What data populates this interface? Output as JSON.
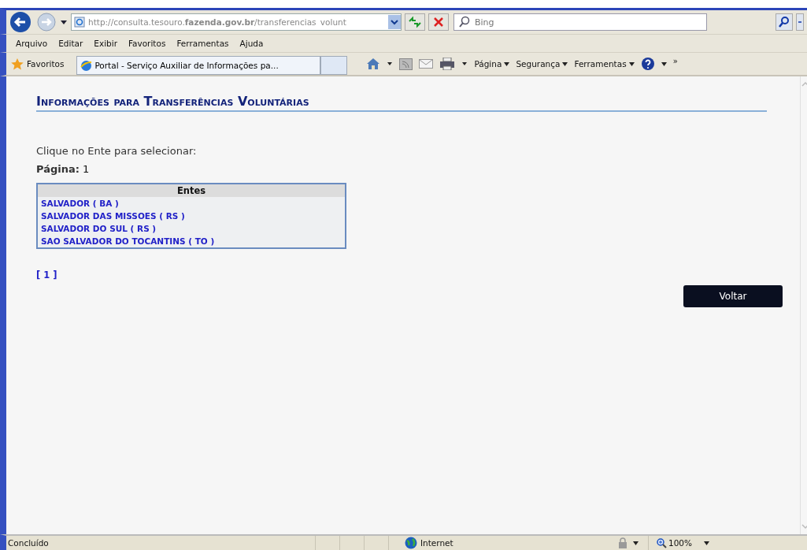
{
  "address_bar": {
    "url": "http://consulta.tesouro.**fazenda.gov.br**/transferencias_volunt",
    "search_placeholder": "Bing"
  },
  "menu": [
    "Arquivo",
    "Editar",
    "Exibir",
    "Favoritos",
    "Ferramentas",
    "Ajuda"
  ],
  "favorites_bar": {
    "favorites": "Favoritos",
    "tabs": [
      {
        "label": "Portal - Serviço Auxiliar de Informações pa...",
        "selected": true
      }
    ],
    "commands": [
      "Página",
      "Segurança",
      "Ferramentas"
    ],
    "overflow": "»"
  },
  "page": {
    "title": "Informações para Transferências Voluntárias",
    "instruction": "Clique no Ente para selecionar:",
    "page_label": "Página:",
    "page_number": "1",
    "table": {
      "header": "Entes",
      "rows": [
        "SALVADOR ( BA )",
        "SALVADOR DAS MISSOES ( RS )",
        "SALVADOR DO SUL ( RS )",
        "SAO SALVADOR DO TOCANTINS ( TO )"
      ]
    },
    "pagination": "[ 1 ]",
    "back_button": "Voltar"
  },
  "status_bar": {
    "status": "Concluído",
    "zone": "Internet",
    "zoom": "100%"
  }
}
